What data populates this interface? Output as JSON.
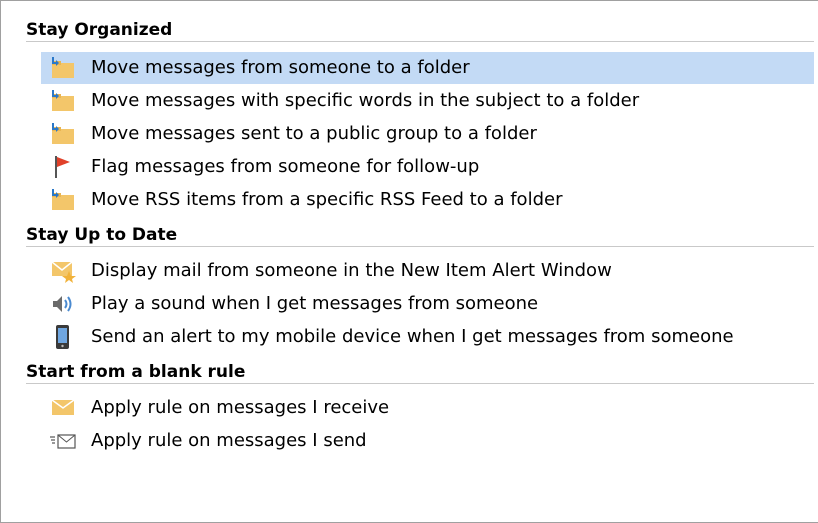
{
  "groups": [
    {
      "title": "Stay Organized",
      "items": [
        {
          "label": "Move messages from someone to a folder",
          "icon": "folder-move-icon",
          "selected": true
        },
        {
          "label": "Move messages with specific words in the subject to a folder",
          "icon": "folder-move-icon"
        },
        {
          "label": "Move messages sent to a public group to a folder",
          "icon": "folder-move-icon"
        },
        {
          "label": "Flag messages from someone for follow-up",
          "icon": "flag-icon"
        },
        {
          "label": "Move RSS items from a specific RSS Feed to a folder",
          "icon": "folder-move-icon"
        }
      ]
    },
    {
      "title": "Stay Up to Date",
      "items": [
        {
          "label": "Display mail from someone in the New Item Alert Window",
          "icon": "mail-alert-icon"
        },
        {
          "label": "Play a sound when I get messages from someone",
          "icon": "speaker-icon"
        },
        {
          "label": "Send an alert to my mobile device when I get messages from someone",
          "icon": "mobile-device-icon"
        }
      ]
    },
    {
      "title": "Start from a blank rule",
      "items": [
        {
          "label": "Apply rule on messages I receive",
          "icon": "envelope-icon"
        },
        {
          "label": "Apply rule on messages I send",
          "icon": "send-message-icon"
        }
      ]
    }
  ],
  "colors": {
    "selection": "#c3daf5",
    "folder": "#f3c66a",
    "flag": "#e0412a",
    "arrow": "#2a78c8"
  }
}
